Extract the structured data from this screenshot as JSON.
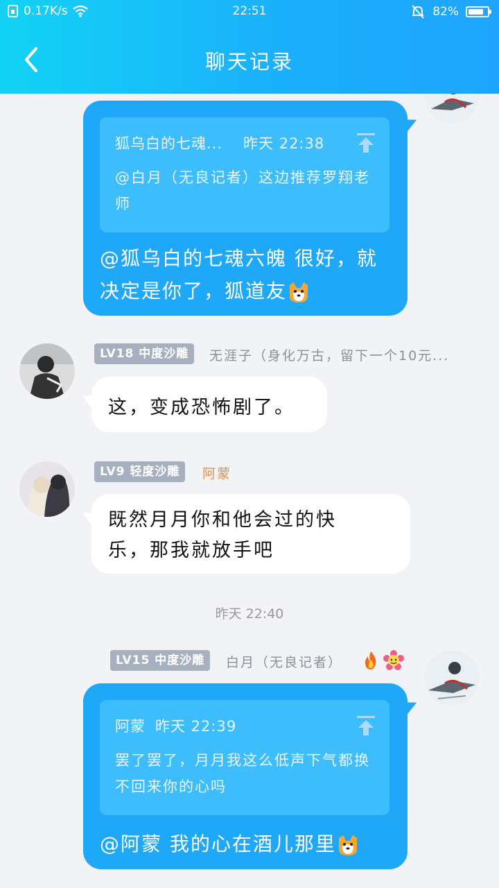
{
  "status": {
    "speed": "0.17K/s",
    "time": "22:51",
    "battery": "82%",
    "battery_level": 0.82
  },
  "header": {
    "title": "聊天记录",
    "back_icon": "chevron-left-icon"
  },
  "messages": {
    "m1": {
      "quote_author": "狐乌白的七魂...",
      "quote_time": "昨天 22:38",
      "quote_text": "@白月（无良记者）这边推荐罗翔老师",
      "line1": "@狐乌白的七魂六魄 很好，就",
      "line2": "决定是你了，狐道友"
    },
    "m2": {
      "badge": "LV18 中度沙雕",
      "nick": "无涯子（身化万古，留下一个10元...",
      "text": "这，变成恐怖剧了。"
    },
    "m3": {
      "badge": "LV9 轻度沙雕",
      "nick": "阿蒙",
      "nick_color": "#e0904a",
      "line1": "既然月月你和他会过的快",
      "line2": "乐，那我就放手吧"
    },
    "timestamp": "昨天 22:40",
    "m4": {
      "badge": "LV15 中度沙雕",
      "nick": "白月（无良记者）",
      "quote_author": "阿蒙",
      "quote_time": "昨天 22:39",
      "quote_text": "罢了罢了，月月我这么低声下气都换不回来你的心吗",
      "text": "@阿蒙 我的心在酒儿那里"
    }
  },
  "colors": {
    "accent": "#1fa8f7",
    "header_start": "#12d3f5",
    "header_end": "#1ea4fd"
  }
}
